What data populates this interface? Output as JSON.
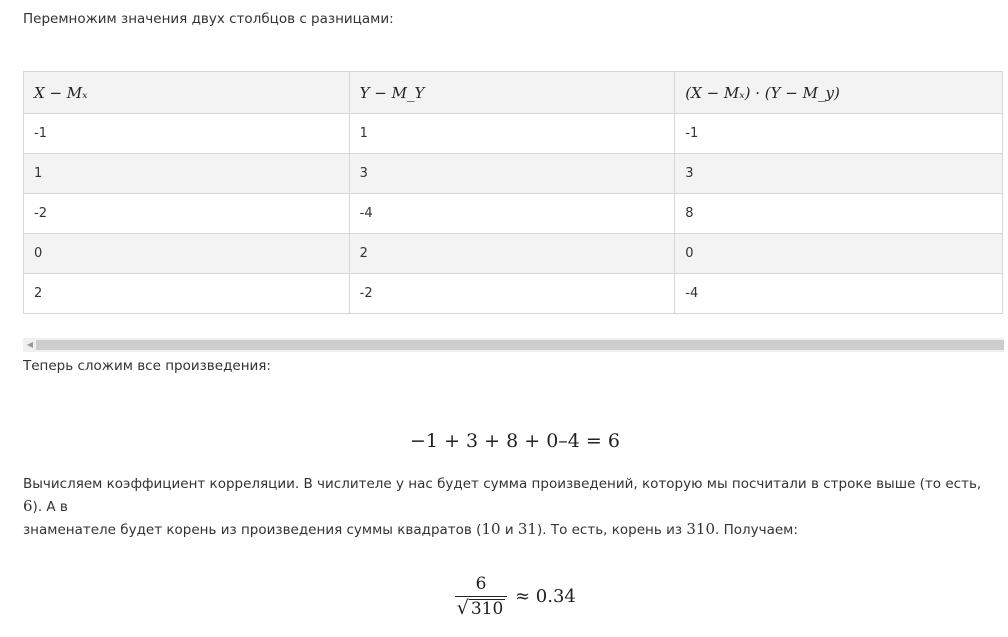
{
  "intro_text": "Перемножим значения двух столбцов с разницами:",
  "table": {
    "headers": [
      "X − Mₓ",
      "Y − M_Y",
      "(X − Mₓ) · (Y − M_y)"
    ],
    "rows": [
      [
        "-1",
        "1",
        "-1"
      ],
      [
        "1",
        "3",
        "3"
      ],
      [
        "-2",
        "-4",
        "8"
      ],
      [
        "0",
        "2",
        "0"
      ],
      [
        "2",
        "-2",
        "-4"
      ]
    ]
  },
  "sum_intro": "Теперь сложим все произведения:",
  "sum_equation": "−1 + 3 + 8 + 0–4 = 6",
  "explanation": {
    "line1_a": "Вычисляем коэффициент корреляции. В числителе у нас будет сумма произведений, которую мы посчитали в строке выше (то есть, ",
    "line1_num": "6",
    "line1_b": "). А в",
    "line2_a": "знаменателе будет корень из произведения суммы квадратов (",
    "line2_num1": "10",
    "line2_mid": " и ",
    "line2_num2": "31",
    "line2_b": "). То есть, корень из ",
    "line2_num3": "310",
    "line2_c": ". Получаем:"
  },
  "result_formula": {
    "numerator": "6",
    "radicand": "310",
    "sqrt_symbol": "√",
    "approx": "≈ 0.34"
  }
}
